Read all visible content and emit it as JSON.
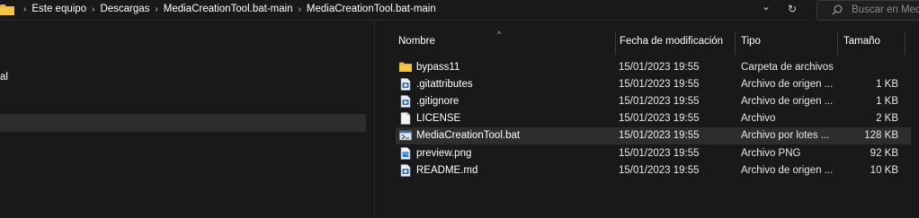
{
  "address": {
    "crumbs": [
      "Este equipo",
      "Descargas",
      "MediaCreationTool.bat-main",
      "MediaCreationTool.bat-main"
    ],
    "separator": "›",
    "dropdown_glyph": "⌄",
    "refresh_glyph": "↻"
  },
  "search": {
    "placeholder": "Buscar en Media"
  },
  "nav": {
    "items": [
      {
        "label": "al"
      },
      {
        "label": ""
      }
    ]
  },
  "columns": {
    "name": "Nombre",
    "date": "Fecha de modificación",
    "type": "Tipo",
    "size": "Tamaño"
  },
  "files": [
    {
      "name": "bypass11",
      "date": "15/01/2023 19:55",
      "type": "Carpeta de archivos",
      "size": "",
      "icon": "folder-icon"
    },
    {
      "name": ".gitattributes",
      "date": "15/01/2023 19:55",
      "type": "Archivo de origen ...",
      "size": "1 KB",
      "icon": "source-file-icon"
    },
    {
      "name": ".gitignore",
      "date": "15/01/2023 19:55",
      "type": "Archivo de origen ...",
      "size": "1 KB",
      "icon": "source-file-icon"
    },
    {
      "name": "LICENSE",
      "date": "15/01/2023 19:55",
      "type": "Archivo",
      "size": "2 KB",
      "icon": "file-icon"
    },
    {
      "name": "MediaCreationTool.bat",
      "date": "15/01/2023 19:55",
      "type": "Archivo por lotes ...",
      "size": "128 KB",
      "icon": "batch-file-icon"
    },
    {
      "name": "preview.png",
      "date": "15/01/2023 19:55",
      "type": "Archivo PNG",
      "size": "92 KB",
      "icon": "image-file-icon"
    },
    {
      "name": "README.md",
      "date": "15/01/2023 19:55",
      "type": "Archivo de origen ...",
      "size": "10 KB",
      "icon": "source-file-icon"
    }
  ],
  "colors": {
    "background": "#191919",
    "selection": "#2d2d2d",
    "folder": "#f3c545",
    "accent": "#4a9fe8"
  }
}
